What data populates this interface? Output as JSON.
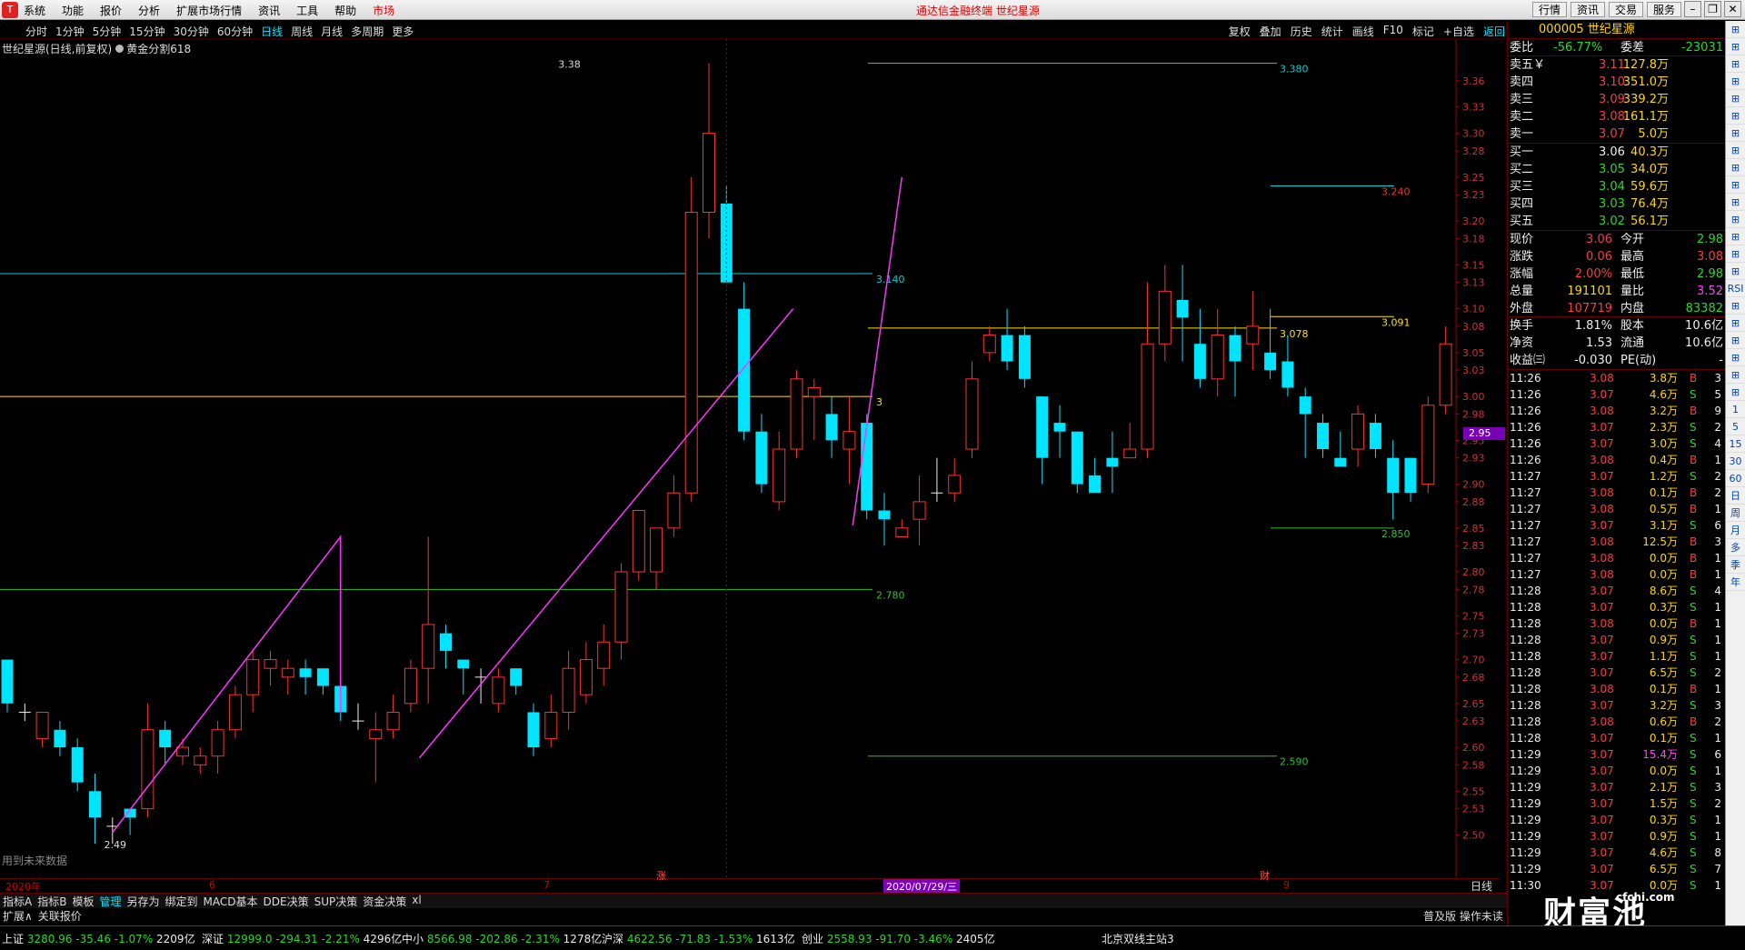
{
  "topbar": {
    "menu": [
      "系统",
      "功能",
      "报价",
      "分析",
      "扩展市场行情",
      "资讯",
      "工具",
      "帮助"
    ],
    "market": "市场",
    "title": "通达信金融终端  世纪星源",
    "right": [
      "行情",
      "资讯",
      "交易",
      "服务"
    ]
  },
  "periods": [
    "分时",
    "1分钟",
    "5分钟",
    "15分钟",
    "30分钟",
    "60分钟",
    "日线",
    "周线",
    "月线",
    "多周期",
    "更多"
  ],
  "active_period": "日线",
  "tools": [
    "复权",
    "叠加",
    "历史",
    "统计",
    "画线",
    "F10",
    "标记",
    "+自选",
    "返回"
  ],
  "stock_info": {
    "name_line": "世纪星源(日线,前复权)",
    "indicator": "黄金分割618"
  },
  "no_future": "用到未来数据",
  "price_tag": "2.95",
  "x_labels": {
    "year": "2020年",
    "m6": "6",
    "m7": "7",
    "date": "2020/07/29/三",
    "m9": "9",
    "rise": "涨",
    "cai": "财"
  },
  "day_label": "日线",
  "chart_data": {
    "type": "candlestick",
    "y_ticks": [
      "3.36",
      "3.33",
      "3.30",
      "3.28",
      "3.25",
      "3.23",
      "3.20",
      "3.18",
      "3.15",
      "3.13",
      "3.10",
      "3.08",
      "3.05",
      "3.03",
      "3.00",
      "2.98",
      "2.95",
      "2.93",
      "2.90",
      "2.88",
      "2.85",
      "2.83",
      "2.80",
      "2.78",
      "2.75",
      "2.73",
      "2.70",
      "2.68",
      "2.65",
      "2.63",
      "2.60",
      "2.58",
      "2.55",
      "2.53",
      "2.50"
    ],
    "ylim": [
      2.49,
      3.38
    ],
    "candles": [
      [
        2.7,
        2.65,
        2.7,
        2.64
      ],
      [
        2.64,
        2.64,
        2.65,
        2.63
      ],
      [
        2.61,
        2.64,
        2.64,
        2.6
      ],
      [
        2.62,
        2.6,
        2.63,
        2.59
      ],
      [
        2.6,
        2.56,
        2.61,
        2.55
      ],
      [
        2.55,
        2.52,
        2.57,
        2.49
      ],
      [
        2.51,
        2.51,
        2.52,
        2.49
      ],
      [
        2.53,
        2.52,
        2.53,
        2.5
      ],
      [
        2.53,
        2.62,
        2.65,
        2.52
      ],
      [
        2.62,
        2.6,
        2.63,
        2.58
      ],
      [
        2.59,
        2.6,
        2.61,
        2.58
      ],
      [
        2.58,
        2.59,
        2.6,
        2.57
      ],
      [
        2.59,
        2.62,
        2.63,
        2.57
      ],
      [
        2.62,
        2.66,
        2.67,
        2.61
      ],
      [
        2.66,
        2.7,
        2.71,
        2.64
      ],
      [
        2.69,
        2.7,
        2.71,
        2.67
      ],
      [
        2.68,
        2.69,
        2.7,
        2.66
      ],
      [
        2.69,
        2.68,
        2.7,
        2.66
      ],
      [
        2.69,
        2.67,
        2.69,
        2.66
      ],
      [
        2.67,
        2.64,
        2.68,
        2.63
      ],
      [
        2.63,
        2.63,
        2.65,
        2.62
      ],
      [
        2.61,
        2.62,
        2.64,
        2.56
      ],
      [
        2.62,
        2.64,
        2.66,
        2.61
      ],
      [
        2.65,
        2.69,
        2.7,
        2.64
      ],
      [
        2.69,
        2.74,
        2.84,
        2.65
      ],
      [
        2.73,
        2.71,
        2.74,
        2.69
      ],
      [
        2.7,
        2.69,
        2.7,
        2.66
      ],
      [
        2.68,
        2.68,
        2.69,
        2.65
      ],
      [
        2.65,
        2.68,
        2.69,
        2.64
      ],
      [
        2.69,
        2.67,
        2.69,
        2.66
      ],
      [
        2.64,
        2.6,
        2.65,
        2.59
      ],
      [
        2.61,
        2.64,
        2.66,
        2.6
      ],
      [
        2.64,
        2.69,
        2.71,
        2.62
      ],
      [
        2.66,
        2.7,
        2.72,
        2.65
      ],
      [
        2.69,
        2.72,
        2.74,
        2.67
      ],
      [
        2.72,
        2.8,
        2.81,
        2.7
      ],
      [
        2.8,
        2.87,
        2.87,
        2.79
      ],
      [
        2.8,
        2.85,
        2.85,
        2.78
      ],
      [
        2.85,
        2.89,
        2.91,
        2.84
      ],
      [
        2.89,
        3.21,
        3.25,
        2.88
      ],
      [
        3.21,
        3.3,
        3.38,
        3.18
      ],
      [
        3.22,
        3.13,
        3.24,
        3.15
      ],
      [
        3.1,
        2.96,
        3.13,
        2.95
      ],
      [
        2.96,
        2.9,
        2.98,
        2.89
      ],
      [
        2.88,
        2.94,
        2.96,
        2.87
      ],
      [
        2.94,
        3.02,
        3.03,
        2.93
      ],
      [
        3.0,
        3.01,
        3.02,
        2.95
      ],
      [
        2.98,
        2.95,
        3.0,
        2.93
      ],
      [
        2.94,
        2.96,
        3.0,
        2.9
      ],
      [
        2.97,
        2.87,
        2.98,
        2.86
      ],
      [
        2.87,
        2.86,
        2.89,
        2.83
      ],
      [
        2.84,
        2.85,
        2.86,
        2.84
      ],
      [
        2.86,
        2.88,
        2.91,
        2.83
      ],
      [
        2.89,
        2.89,
        2.93,
        2.88
      ],
      [
        2.89,
        2.91,
        2.93,
        2.88
      ],
      [
        2.94,
        3.02,
        3.04,
        2.93
      ],
      [
        3.05,
        3.07,
        3.08,
        3.04
      ],
      [
        3.07,
        3.04,
        3.1,
        3.03
      ],
      [
        3.07,
        3.02,
        3.08,
        3.01
      ],
      [
        3.0,
        2.93,
        3.0,
        2.9
      ],
      [
        2.97,
        2.96,
        2.99,
        2.93
      ],
      [
        2.96,
        2.9,
        2.96,
        2.89
      ],
      [
        2.91,
        2.89,
        2.93,
        2.89
      ],
      [
        2.93,
        2.92,
        2.96,
        2.89
      ],
      [
        2.93,
        2.94,
        2.97,
        2.93
      ],
      [
        2.94,
        3.06,
        3.13,
        2.93
      ],
      [
        3.06,
        3.12,
        3.15,
        3.04
      ],
      [
        3.11,
        3.09,
        3.15,
        3.04
      ],
      [
        3.06,
        3.02,
        3.1,
        3.01
      ],
      [
        3.02,
        3.07,
        3.1,
        3.0
      ],
      [
        3.07,
        3.04,
        3.08,
        3.0
      ],
      [
        3.06,
        3.08,
        3.12,
        3.03
      ],
      [
        3.05,
        3.03,
        3.1,
        3.02
      ],
      [
        3.04,
        3.01,
        3.07,
        3.0
      ],
      [
        3.0,
        2.98,
        3.01,
        2.93
      ],
      [
        2.97,
        2.94,
        2.98,
        2.93
      ],
      [
        2.93,
        2.92,
        2.96,
        2.92
      ],
      [
        2.94,
        2.98,
        2.99,
        2.92
      ],
      [
        2.97,
        2.94,
        2.98,
        2.93
      ],
      [
        2.93,
        2.89,
        2.95,
        2.86
      ],
      [
        2.93,
        2.89,
        2.93,
        2.88
      ],
      [
        2.9,
        2.99,
        3.0,
        2.89
      ],
      [
        2.99,
        3.06,
        3.08,
        2.98
      ]
    ],
    "golden_lines": [
      {
        "label": "3.380",
        "price": 3.38,
        "color": "#00d0d0"
      },
      {
        "label": "3.140",
        "price": 3.14,
        "color": "#00d0d0"
      },
      {
        "label": "3.078",
        "price": 3.078,
        "color": "#ffe000"
      },
      {
        "label": "3",
        "price": 3.0,
        "color": "#ffe000"
      },
      {
        "label": "2.780",
        "price": 2.78,
        "color": "#30c030"
      },
      {
        "label": "2.590",
        "price": 2.59,
        "color": "#30c030"
      },
      {
        "label": "3.240",
        "price": 3.24,
        "color": "#00d0d0"
      },
      {
        "label": "3.091",
        "price": 3.091,
        "color": "#ffe000"
      },
      {
        "label": "2.850",
        "price": 2.85,
        "color": "#30c030"
      }
    ],
    "high_label": "3.38",
    "low_label": "2.49",
    "colors": {
      "up": "#ff3030",
      "down": "#00e5ff",
      "wave": "#ff33ff"
    }
  },
  "quote": {
    "code_name": "000005 世纪星源",
    "weibi_label": "委比",
    "weibi": "-56.77%",
    "weicha_label": "委差",
    "weicha": "-23031",
    "sell": [
      [
        "卖五￥",
        "3.11",
        "127.8万"
      ],
      [
        "卖四",
        "3.10",
        "351.0万"
      ],
      [
        "卖三",
        "3.09",
        "339.2万"
      ],
      [
        "卖二",
        "3.08",
        "161.1万"
      ],
      [
        "卖一",
        "3.07",
        "5.0万"
      ]
    ],
    "buy": [
      [
        "买一",
        "3.06",
        "40.3万"
      ],
      [
        "买二",
        "3.05",
        "34.0万"
      ],
      [
        "买三",
        "3.04",
        "59.6万"
      ],
      [
        "买四",
        "3.03",
        "76.4万"
      ],
      [
        "买五",
        "3.02",
        "56.1万"
      ]
    ],
    "stats": [
      [
        "现价",
        "3.06",
        "今开",
        "2.98"
      ],
      [
        "涨跌",
        "0.06",
        "最高",
        "3.08"
      ],
      [
        "涨幅",
        "2.00%",
        "最低",
        "2.98"
      ],
      [
        "总量",
        "191101",
        "量比",
        "3.52"
      ],
      [
        "外盘",
        "107719",
        "内盘",
        "83382"
      ],
      [
        "换手",
        "1.81%",
        "股本",
        "10.6亿"
      ],
      [
        "净资",
        "1.53",
        "流通",
        "10.6亿"
      ],
      [
        "收益㈢",
        "-0.030",
        "PE(动)",
        "-"
      ]
    ],
    "ticks": [
      [
        "11:26",
        "3.08",
        "3.8万",
        "B",
        "3"
      ],
      [
        "11:26",
        "3.07",
        "4.6万",
        "S",
        "5"
      ],
      [
        "11:26",
        "3.08",
        "3.2万",
        "B",
        "9"
      ],
      [
        "11:26",
        "3.07",
        "2.3万",
        "S",
        "2"
      ],
      [
        "11:26",
        "3.07",
        "3.0万",
        "S",
        "4"
      ],
      [
        "11:26",
        "3.08",
        "0.4万",
        "B",
        "1"
      ],
      [
        "11:27",
        "3.07",
        "1.2万",
        "S",
        "2"
      ],
      [
        "11:27",
        "3.08",
        "0.1万",
        "B",
        "2"
      ],
      [
        "11:27",
        "3.08",
        "0.5万",
        "B",
        "1"
      ],
      [
        "11:27",
        "3.07",
        "3.1万",
        "S",
        "6"
      ],
      [
        "11:27",
        "3.08",
        "12.5万",
        "B",
        "3"
      ],
      [
        "11:27",
        "3.08",
        "0.0万",
        "B",
        "1"
      ],
      [
        "11:27",
        "3.08",
        "0.0万",
        "B",
        "1"
      ],
      [
        "11:28",
        "3.07",
        "8.6万",
        "S",
        "4"
      ],
      [
        "11:28",
        "3.07",
        "0.3万",
        "S",
        "1"
      ],
      [
        "11:28",
        "3.08",
        "0.0万",
        "B",
        "1"
      ],
      [
        "11:28",
        "3.07",
        "0.9万",
        "S",
        "1"
      ],
      [
        "11:28",
        "3.07",
        "1.1万",
        "S",
        "1"
      ],
      [
        "11:28",
        "3.07",
        "6.5万",
        "S",
        "2"
      ],
      [
        "11:28",
        "3.08",
        "0.1万",
        "B",
        "1"
      ],
      [
        "11:28",
        "3.07",
        "3.2万",
        "S",
        "3"
      ],
      [
        "11:28",
        "3.08",
        "0.6万",
        "B",
        "2"
      ],
      [
        "11:28",
        "3.07",
        "0.1万",
        "S",
        "1"
      ],
      [
        "11:29",
        "3.07",
        "15.4万",
        "S",
        "6"
      ],
      [
        "11:29",
        "3.07",
        "0.0万",
        "S",
        "1"
      ],
      [
        "11:29",
        "3.07",
        "2.1万",
        "S",
        "3"
      ],
      [
        "11:29",
        "3.07",
        "1.5万",
        "S",
        "2"
      ],
      [
        "11:29",
        "3.07",
        "0.3万",
        "S",
        "1"
      ],
      [
        "11:29",
        "3.07",
        "0.9万",
        "S",
        "1"
      ],
      [
        "11:29",
        "3.07",
        "4.6万",
        "S",
        "8"
      ],
      [
        "11:29",
        "3.07",
        "6.5万",
        "S",
        "7"
      ],
      [
        "11:30",
        "3.07",
        "0.0万",
        "S",
        "1"
      ]
    ]
  },
  "tabs": [
    "指标A",
    "指标B",
    "模板",
    "管理",
    "另存为",
    "绑定到",
    "MACD基本",
    "DDE决策",
    "SUP决策",
    "资金决策",
    "xl"
  ],
  "active_tab": "管理",
  "tabs2": [
    "扩展∧",
    "关联报价"
  ],
  "mini_right": "普及版 操作未读",
  "sidebar": [
    "⊞",
    "⊞",
    "⊞",
    "⊞",
    "⊞",
    "⊞",
    "⊞",
    "⊞",
    "⊞",
    "⊞",
    "⊞",
    "⊞",
    "⊞",
    "⊞",
    "⊞",
    "RSI",
    "⊞",
    "⊞",
    "⊞",
    "⊞",
    "⊞",
    "⊞",
    "1",
    "5",
    "15",
    "30",
    "60",
    "日",
    "周",
    "月",
    "多",
    "季",
    "年"
  ],
  "status": {
    "items": [
      {
        "name": "上证",
        "val": "3280.96",
        "chg": "-35.46",
        "pct": "-1.07%",
        "amt": "2209亿"
      },
      {
        "name": "深证",
        "val": "12999.0",
        "chg": "-294.31",
        "pct": "-2.21%",
        "amt": "4296亿"
      },
      {
        "name": "中小",
        "val": "8566.98",
        "chg": "-202.86",
        "pct": "-2.31%",
        "amt": "1278亿"
      },
      {
        "name": "沪深",
        "val": "4622.56",
        "chg": "-71.83",
        "pct": "-1.53%",
        "amt": "1613亿"
      },
      {
        "name": "创业",
        "val": "2558.93",
        "chg": "-91.70",
        "pct": "-3.46%",
        "amt": "2405亿"
      }
    ],
    "server": "北京双线主站3"
  },
  "watermark": "财富池",
  "watermark_url": "cfchi.com"
}
